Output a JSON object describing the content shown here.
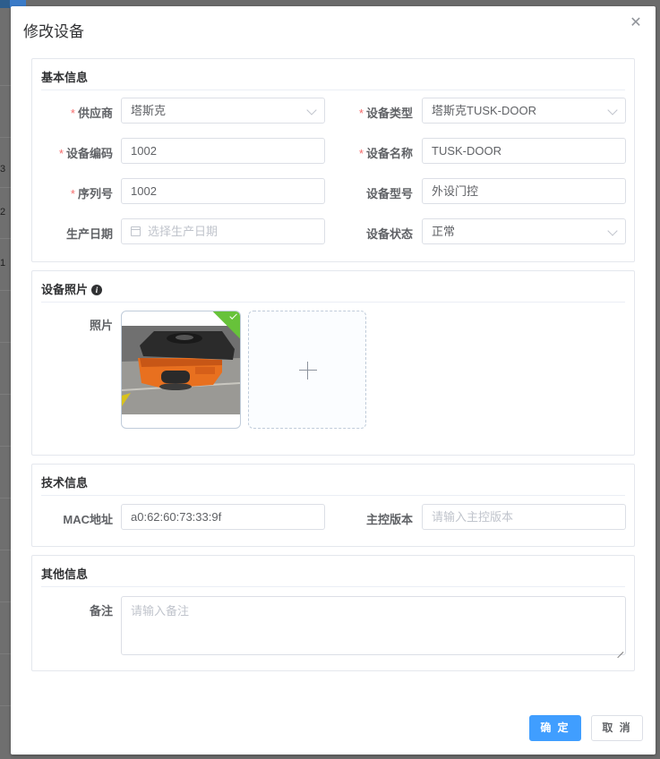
{
  "background": {
    "row_numbers": [
      "3",
      "2",
      "1"
    ]
  },
  "dialog": {
    "title": "修改设备",
    "close_icon": "close-icon"
  },
  "basic_info": {
    "title": "基本信息",
    "supplier": {
      "label": "供应商",
      "value": "塔斯克",
      "required": true
    },
    "device_type": {
      "label": "设备类型",
      "value": "塔斯克TUSK-DOOR",
      "required": true
    },
    "device_code": {
      "label": "设备编码",
      "value": "1002",
      "required": true
    },
    "device_name": {
      "label": "设备名称",
      "value": "TUSK-DOOR",
      "required": true
    },
    "serial_no": {
      "label": "序列号",
      "value": "1002",
      "required": true
    },
    "device_model": {
      "label": "设备型号",
      "value": "外设门控",
      "required": false
    },
    "production_date": {
      "label": "生产日期",
      "placeholder": "选择生产日期",
      "required": false
    },
    "device_status": {
      "label": "设备状态",
      "value": "正常",
      "required": false
    }
  },
  "photo_section": {
    "title": "设备照片",
    "info_icon": "info-icon",
    "photo_label": "照片",
    "upload_icon": "plus-icon"
  },
  "tech_info": {
    "title": "技术信息",
    "mac": {
      "label": "MAC地址",
      "value": "a0:62:60:73:33:9f"
    },
    "firmware": {
      "label": "主控版本",
      "placeholder": "请输入主控版本"
    }
  },
  "other_info": {
    "title": "其他信息",
    "remark": {
      "label": "备注",
      "placeholder": "请输入备注"
    }
  },
  "footer": {
    "confirm_label": "确 定",
    "cancel_label": "取 消"
  },
  "colors": {
    "primary": "#409eff",
    "required": "#f56c6c",
    "success": "#67c23a"
  }
}
